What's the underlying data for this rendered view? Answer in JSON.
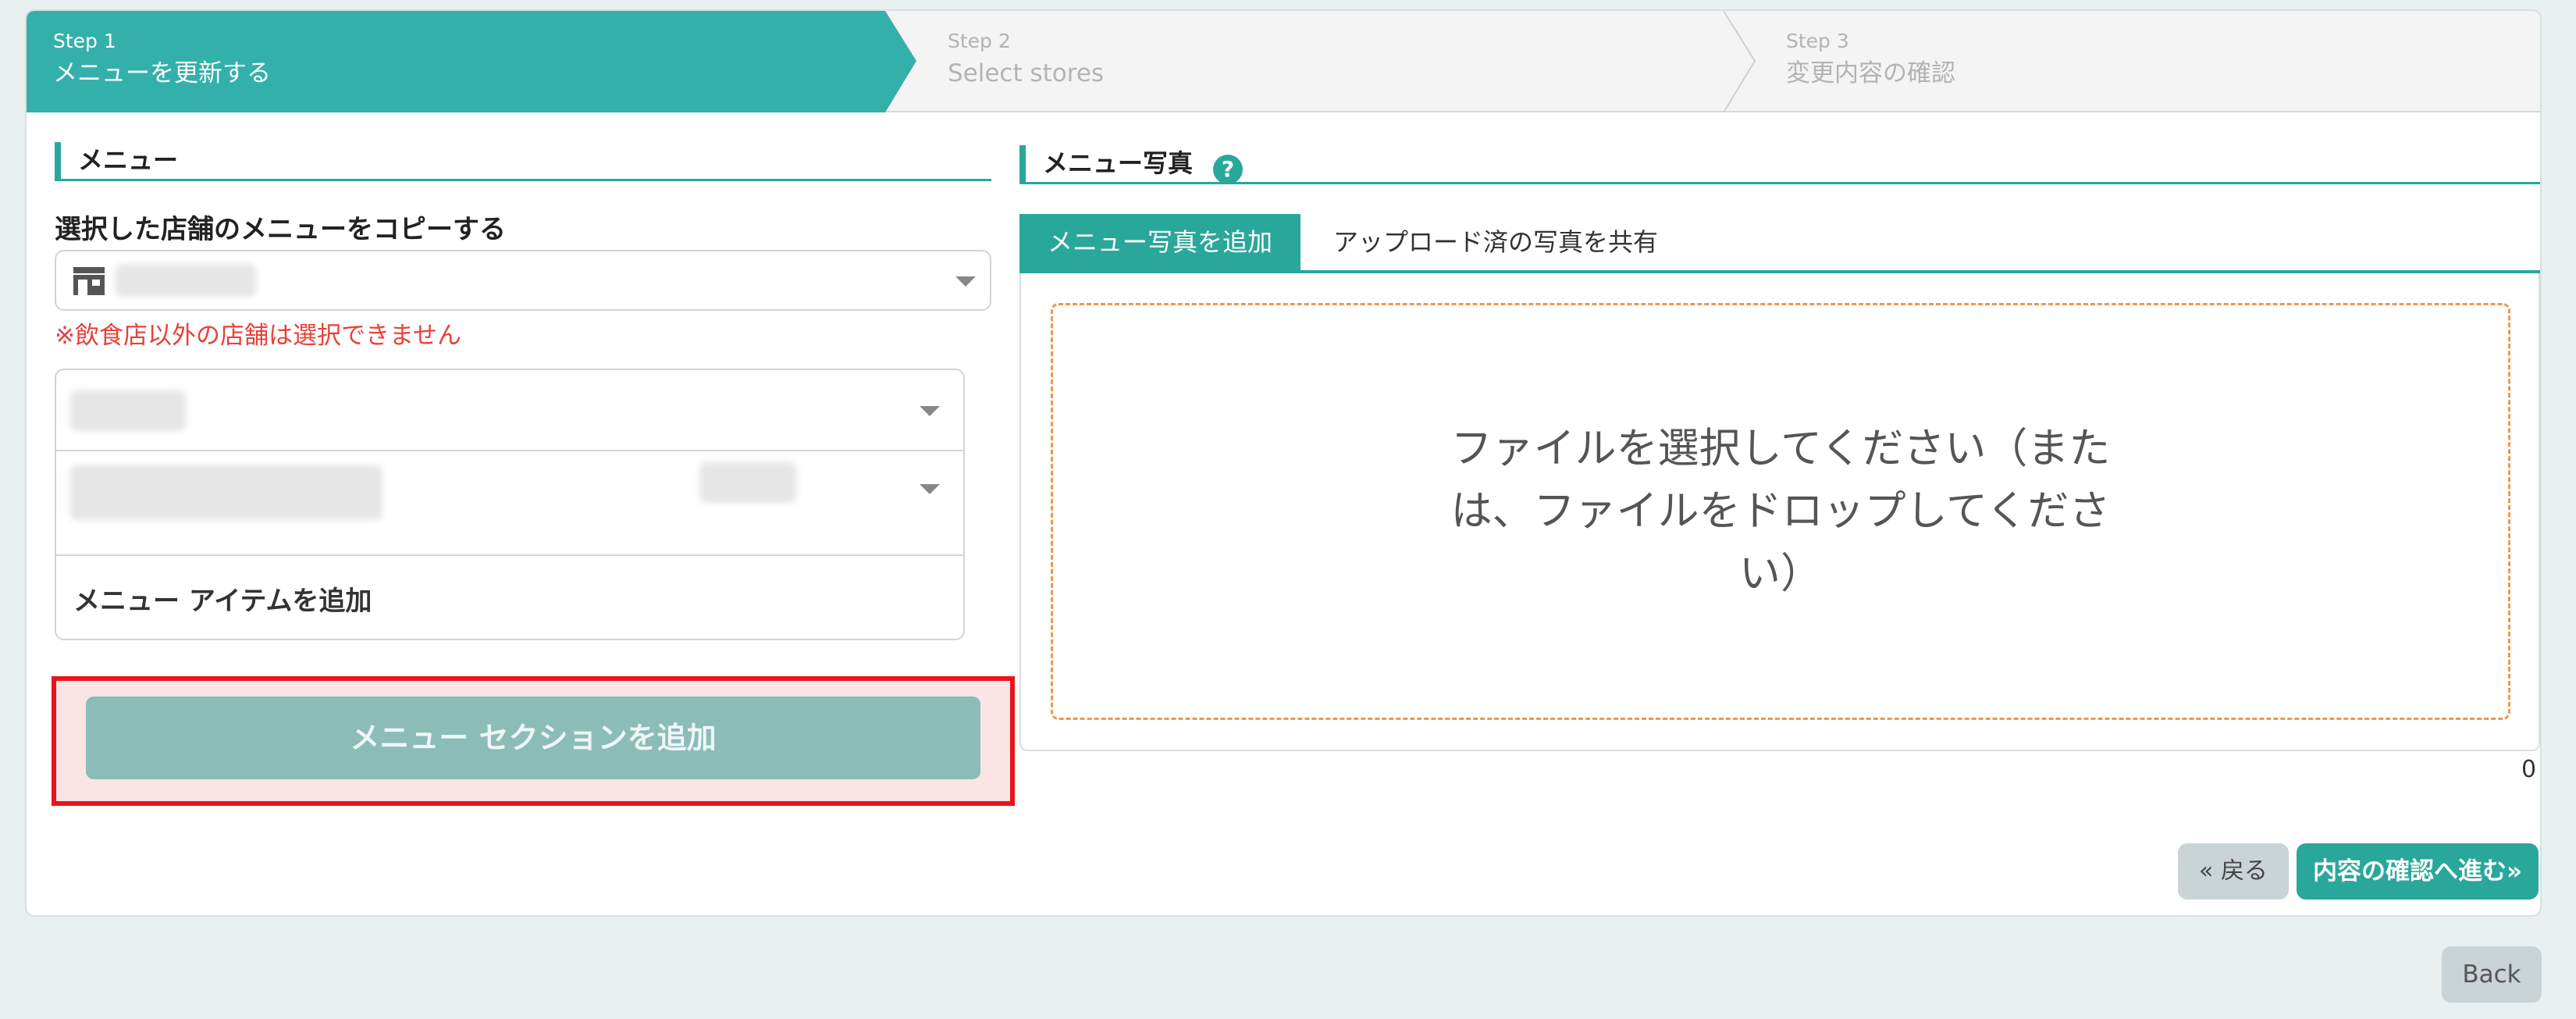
{
  "stepper": {
    "steps": [
      {
        "num": "Step 1",
        "label": "メニューを更新する"
      },
      {
        "num": "Step 2",
        "label": "Select stores"
      },
      {
        "num": "Step 3",
        "label": "変更内容の確認"
      }
    ]
  },
  "menu": {
    "heading": "メニュー",
    "copy_label": "選択した店舗のメニューをコピーする",
    "warning": "※飲食店以外の店舗は選択できません",
    "add_item": "メニュー アイテムを追加",
    "add_section": "メニュー セクションを追加"
  },
  "photos": {
    "heading": "メニュー写真",
    "help": "?",
    "tab_add": "メニュー写真を追加",
    "tab_share": "アップロード済の写真を共有",
    "drop_text": "ファイルを選択してください（または、ファイルをドロップしてください）",
    "count": "0"
  },
  "footer": {
    "back_label": "« 戻る",
    "next_label": "内容の確認へ進む»",
    "page_back": "Back"
  },
  "colors": {
    "accent": "#2aa79b",
    "warning": "#e8413a",
    "highlight_border": "#e8141a",
    "disabled_button": "#8bbcb8"
  }
}
